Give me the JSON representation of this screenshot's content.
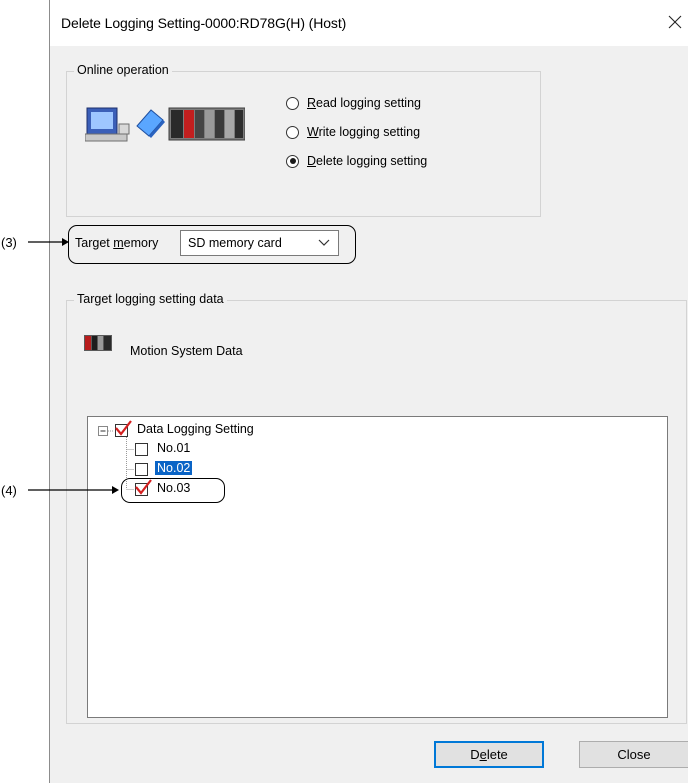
{
  "dialog": {
    "title": "Delete Logging Setting-0000:RD78G(H) (Host)"
  },
  "online_operation": {
    "group_title": "Online operation",
    "options": [
      {
        "prefix": "",
        "key": "R",
        "rest": "ead logging setting",
        "selected": false
      },
      {
        "prefix": "",
        "key": "W",
        "rest": "rite logging setting",
        "selected": false
      },
      {
        "prefix": "",
        "key": "D",
        "rest": "elete logging setting",
        "selected": true
      }
    ]
  },
  "target_memory": {
    "label_prefix": "Target ",
    "label_key": "m",
    "label_rest": "emory",
    "value": "SD memory card"
  },
  "target_data": {
    "group_title": "Target logging setting data",
    "system_label": "Motion System Data",
    "tree": {
      "root": {
        "label": "Data Logging Setting",
        "checked": true,
        "expanded": true
      },
      "children": [
        {
          "label": "No.01",
          "checked": false,
          "highlighted": false
        },
        {
          "label": "No.02",
          "checked": false,
          "highlighted": true
        },
        {
          "label": "No.03",
          "checked": true,
          "highlighted": false
        }
      ]
    }
  },
  "buttons": {
    "delete": {
      "prefix": "D",
      "key": "e",
      "rest": "lete"
    },
    "close": "Close"
  },
  "callouts": {
    "c3": "(3)",
    "c4": "(4)"
  },
  "colors": {
    "accent": "#0078d7",
    "highlight": "#0a64c6",
    "check_red": "#d42020"
  }
}
